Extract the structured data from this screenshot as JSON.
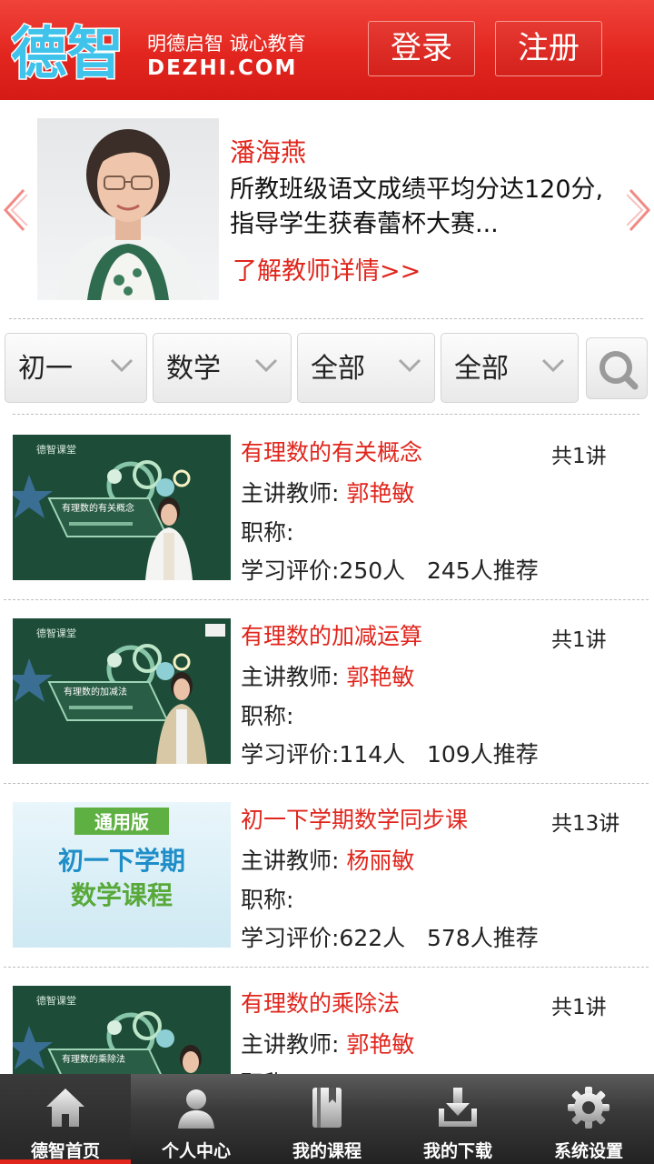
{
  "header": {
    "logo_text": "德智",
    "slogan": "明德启智 诚心教育",
    "site_url": "DEZHI.COM",
    "login_label": "登录",
    "register_label": "注册"
  },
  "teacher": {
    "name": "潘海燕",
    "description": "所教班级语文成绩平均分达120分,指导学生获春蕾杯大赛...",
    "more_link": "了解教师详情>>"
  },
  "filters": {
    "grade": "初一",
    "subject": "数学",
    "filter3": "全部",
    "filter4": "全部"
  },
  "courses": [
    {
      "title": "有理数的有关概念",
      "count": "共1讲",
      "teacher_label": "主讲教师:",
      "teacher": "郭艳敏",
      "rank_label": "职称:",
      "rating": "学习评价:250人",
      "recommend": "245人推荐",
      "thumb_caption": "有理数的有关概念"
    },
    {
      "title": "有理数的加减运算",
      "count": "共1讲",
      "teacher_label": "主讲教师:",
      "teacher": "郭艳敏",
      "rank_label": "职称:",
      "rating": "学习评价:114人",
      "recommend": "109人推荐",
      "thumb_caption": "有理数的加减法"
    },
    {
      "title": "初一下学期数学同步课",
      "count": "共13讲",
      "teacher_label": "主讲教师:",
      "teacher": "杨丽敏",
      "rank_label": "职称:",
      "rating": "学习评价:622人",
      "recommend": "578人推荐",
      "thumb_badge": "通用版",
      "thumb_line1": "初一下学期",
      "thumb_line2": "数学课程"
    },
    {
      "title": "有理数的乘除法",
      "count": "共1讲",
      "teacher_label": "主讲教师:",
      "teacher": "郭艳敏",
      "rank_label": "职称:",
      "thumb_caption": "有理数的乘除法"
    }
  ],
  "thumb_brand": "德智课堂",
  "nav": [
    {
      "label": "德智首页",
      "icon": "home-icon"
    },
    {
      "label": "个人中心",
      "icon": "user-icon"
    },
    {
      "label": "我的课程",
      "icon": "book-icon"
    },
    {
      "label": "我的下载",
      "icon": "download-icon"
    },
    {
      "label": "系统设置",
      "icon": "gear-icon"
    }
  ],
  "colors": {
    "header_red": "#e2261f",
    "accent_red": "#e0251c",
    "nav_dark": "#333333"
  }
}
